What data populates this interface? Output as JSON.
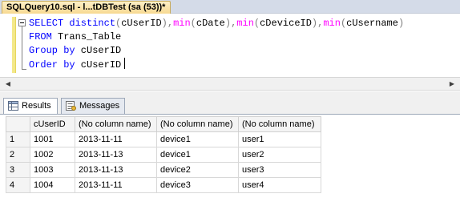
{
  "document_tab": {
    "title": "SQLQuery10.sql - l...tDBTest (sa (53))*"
  },
  "editor": {
    "lines": [
      [
        {
          "t": "SELECT distinct",
          "c": "kw"
        },
        {
          "t": "(",
          "c": "op"
        },
        {
          "t": "cUserID",
          "c": "tx"
        },
        {
          "t": "),",
          "c": "op"
        },
        {
          "t": "min",
          "c": "fn"
        },
        {
          "t": "(",
          "c": "op"
        },
        {
          "t": "cDate",
          "c": "tx"
        },
        {
          "t": "),",
          "c": "op"
        },
        {
          "t": "min",
          "c": "fn"
        },
        {
          "t": "(",
          "c": "op"
        },
        {
          "t": "cDeviceID",
          "c": "tx"
        },
        {
          "t": "),",
          "c": "op"
        },
        {
          "t": "min",
          "c": "fn"
        },
        {
          "t": "(",
          "c": "op"
        },
        {
          "t": "cUsername",
          "c": "tx"
        },
        {
          "t": ")",
          "c": "op"
        }
      ],
      [
        {
          "t": "FROM",
          "c": "kw"
        },
        {
          "t": " Trans_Table",
          "c": "tx"
        }
      ],
      [
        {
          "t": "Group by",
          "c": "kw"
        },
        {
          "t": " cUserID",
          "c": "tx"
        }
      ],
      [
        {
          "t": "Order by",
          "c": "kw"
        },
        {
          "t": " cUserID",
          "c": "tx"
        }
      ]
    ]
  },
  "results": {
    "tabs": [
      {
        "label": "Results",
        "icon": "grid-icon",
        "active": true
      },
      {
        "label": "Messages",
        "icon": "messages-icon",
        "active": false
      }
    ],
    "columns": [
      "cUserID",
      "(No column name)",
      "(No column name)",
      "(No column name)"
    ],
    "rows": [
      {
        "num": "1",
        "cells": [
          "1001",
          "2013-11-11",
          "device1",
          "user1"
        ]
      },
      {
        "num": "2",
        "cells": [
          "1002",
          "2013-11-13",
          "device1",
          "user2"
        ]
      },
      {
        "num": "3",
        "cells": [
          "1003",
          "2013-11-13",
          "device2",
          "user3"
        ]
      },
      {
        "num": "4",
        "cells": [
          "1004",
          "2013-11-11",
          "device3",
          "user4"
        ]
      }
    ]
  },
  "colors": {
    "keyword": "#0000ff",
    "function": "#ff00ff",
    "operator": "#808080",
    "active_tab": "#f7d991"
  }
}
